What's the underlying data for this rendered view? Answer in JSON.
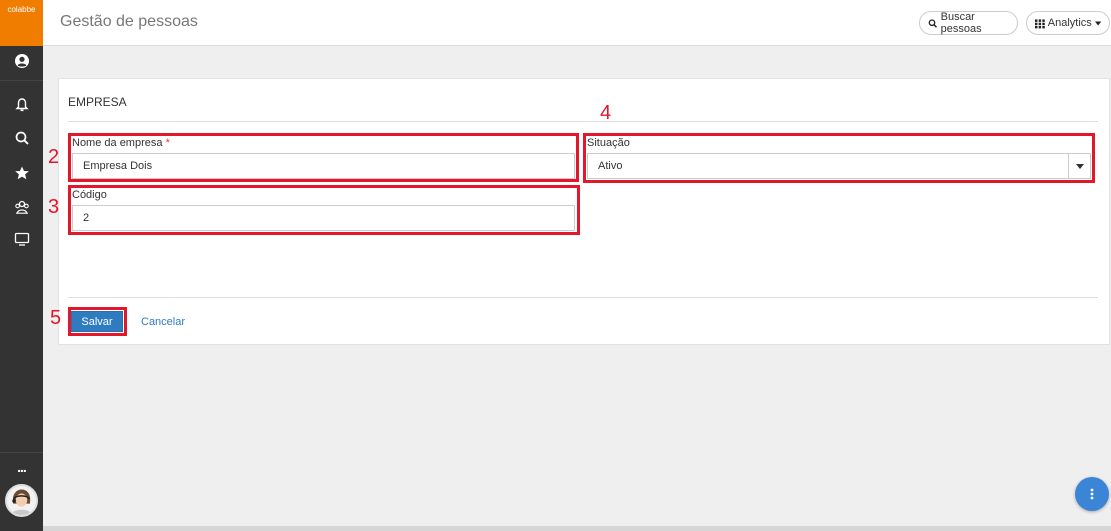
{
  "app": {
    "logo_text": "colabbe",
    "page_title": "Gestão de pessoas"
  },
  "header": {
    "search_button": "Buscar pessoas",
    "analytics_button": "Analytics"
  },
  "sidebar": {
    "icons": [
      "user-circle-icon",
      "bell-icon",
      "search-icon",
      "star-icon",
      "users-icon",
      "monitor-icon"
    ],
    "more_label": "..."
  },
  "form": {
    "section_title": "EMPRESA",
    "company_name": {
      "label": "Nome da empresa",
      "required_mark": "*",
      "value": "Empresa Dois"
    },
    "code": {
      "label": "Código",
      "value": "2"
    },
    "status": {
      "label": "Situação",
      "value": "Ativo"
    },
    "save_label": "Salvar",
    "cancel_label": "Cancelar"
  },
  "annotations": {
    "n2": "2",
    "n3": "3",
    "n4": "4",
    "n5": "5"
  },
  "colors": {
    "accent": "#2f7bbf",
    "highlight": "#e3172b",
    "brand": "#f07c00",
    "sidebar": "#333333"
  }
}
